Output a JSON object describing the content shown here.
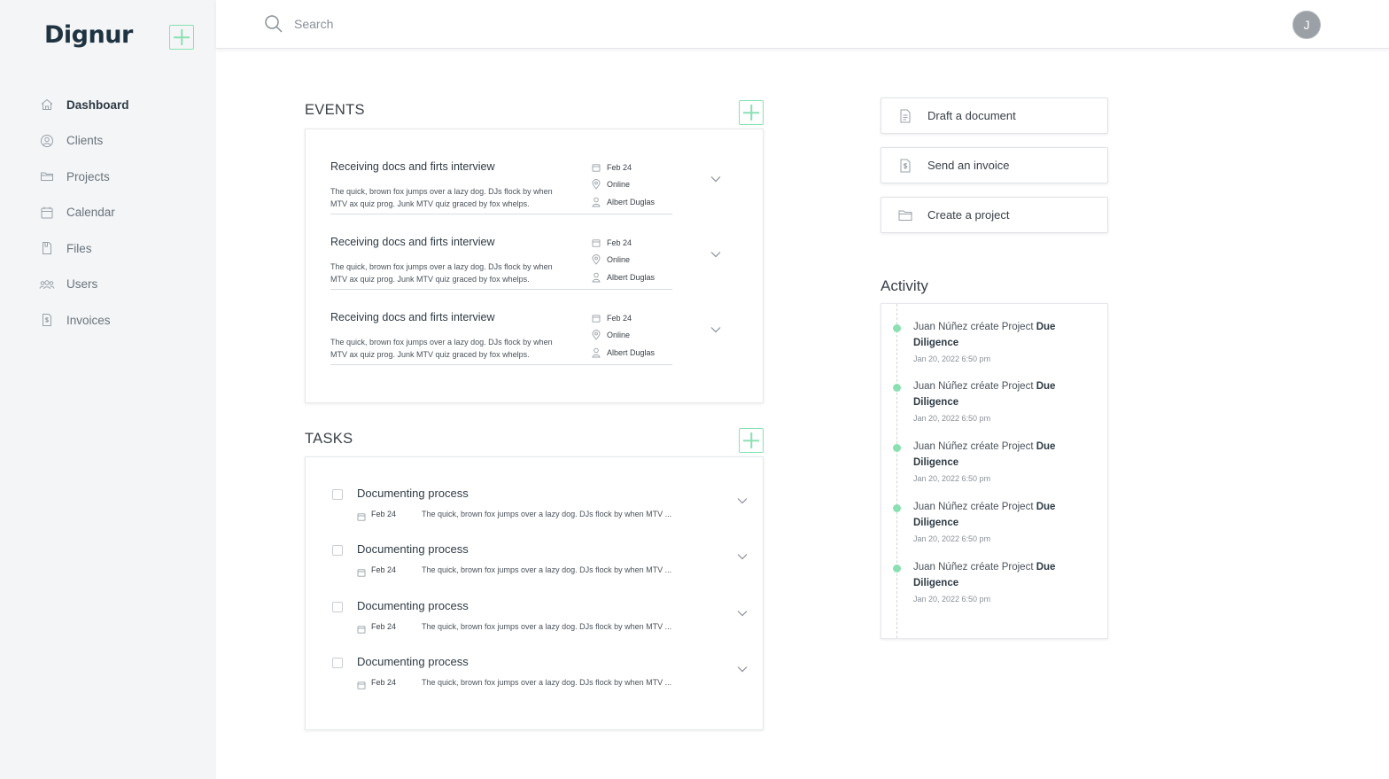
{
  "app": {
    "logo": "Dignur",
    "accent_color": "#8be0b2"
  },
  "sidebar": {
    "items": [
      {
        "label": "Dashboard",
        "icon": "home-icon",
        "active": true
      },
      {
        "label": "Clients",
        "icon": "user-circle-icon",
        "active": false
      },
      {
        "label": "Projects",
        "icon": "folder-icon",
        "active": false
      },
      {
        "label": "Calendar",
        "icon": "calendar-icon",
        "active": false
      },
      {
        "label": "Files",
        "icon": "file-icon",
        "active": false
      },
      {
        "label": "Users",
        "icon": "users-icon",
        "active": false
      },
      {
        "label": "Invoices",
        "icon": "invoice-icon",
        "active": false
      }
    ]
  },
  "topbar": {
    "search_placeholder": "Search",
    "avatar_initial": "J"
  },
  "events": {
    "title": "EVENTS",
    "items": [
      {
        "title": "Receiving docs and firts interview",
        "description": "The quick, brown fox jumps over a lazy dog. DJs flock by when MTV ax quiz prog. Junk MTV quiz graced by fox whelps.",
        "date": "Feb 24",
        "location": "Online",
        "person": "Albert Duglas"
      },
      {
        "title": "Receiving docs and firts interview",
        "description": "The quick, brown fox jumps over a lazy dog. DJs flock by when MTV ax quiz prog. Junk MTV quiz graced by fox whelps.",
        "date": "Feb 24",
        "location": "Online",
        "person": "Albert Duglas"
      },
      {
        "title": "Receiving docs and firts interview",
        "description": "The quick, brown fox jumps over a lazy dog. DJs flock by when MTV ax quiz prog. Junk MTV quiz graced by fox whelps.",
        "date": "Feb 24",
        "location": "Online",
        "person": "Albert Duglas"
      }
    ]
  },
  "tasks": {
    "title": "TASKS",
    "items": [
      {
        "title": "Documenting process",
        "date": "Feb 24",
        "description": "The quick, brown fox jumps over a lazy dog. DJs flock by when MTV ..."
      },
      {
        "title": "Documenting process",
        "date": "Feb 24",
        "description": "The quick, brown fox jumps over a lazy dog. DJs flock by when MTV ..."
      },
      {
        "title": "Documenting process",
        "date": "Feb 24",
        "description": "The quick, brown fox jumps over a lazy dog. DJs flock by when MTV ..."
      },
      {
        "title": "Documenting process",
        "date": "Feb 24",
        "description": "The quick, brown fox jumps over a lazy dog. DJs flock by when MTV ..."
      }
    ]
  },
  "quick_actions": [
    {
      "label": "Draft a document",
      "icon": "document-icon"
    },
    {
      "label": "Send an invoice",
      "icon": "invoice-icon"
    },
    {
      "label": "Create a project",
      "icon": "folder-icon"
    }
  ],
  "activity": {
    "title": "Activity",
    "items": [
      {
        "prefix": "Juan Núñez créate Project ",
        "project": "Due Diligence",
        "time": "Jan 20, 2022 6:50 pm"
      },
      {
        "prefix": "Juan Núñez créate Project ",
        "project": "Due Diligence",
        "time": "Jan 20, 2022 6:50 pm"
      },
      {
        "prefix": "Juan Núñez créate Project ",
        "project": "Due Diligence",
        "time": "Jan 20, 2022 6:50 pm"
      },
      {
        "prefix": "Juan Núñez créate Project ",
        "project": "Due Diligence",
        "time": "Jan 20, 2022 6:50 pm"
      },
      {
        "prefix": "Juan Núñez créate Project ",
        "project": "Due Diligence",
        "time": "Jan 20, 2022 6:50 pm"
      }
    ]
  }
}
